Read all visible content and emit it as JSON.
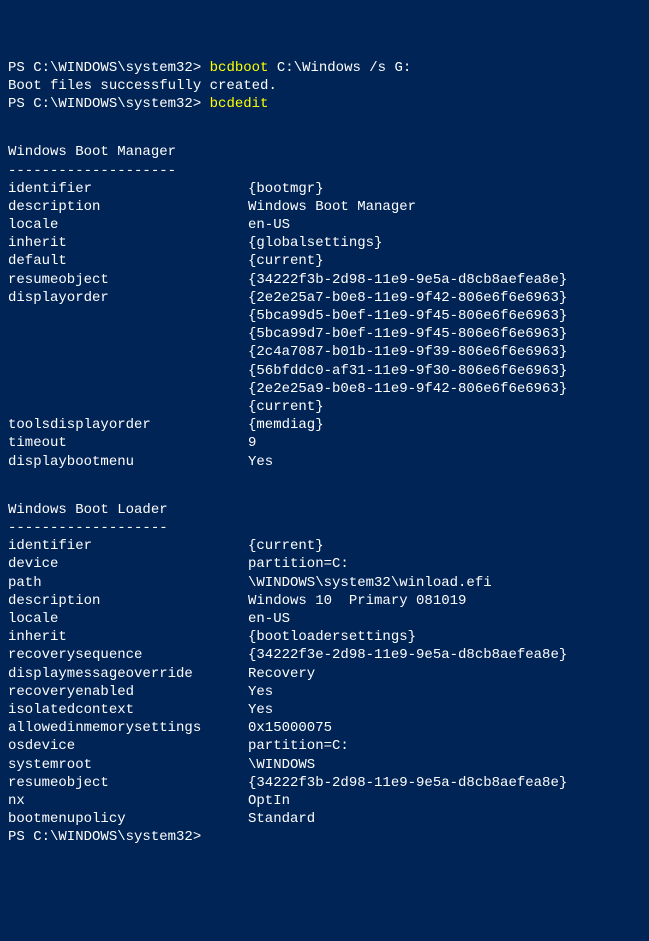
{
  "line1": {
    "prompt": "PS C:\\WINDOWS\\system32> ",
    "cmd": "bcdboot ",
    "args": "C:\\Windows /s G:"
  },
  "line2": "Boot files successfully created.",
  "line3": {
    "prompt": "PS C:\\WINDOWS\\system32> ",
    "cmd": "bcdedit"
  },
  "bootmgr": {
    "title": "Windows Boot Manager",
    "divider": "--------------------",
    "identifier_k": "identifier",
    "identifier_v": "{bootmgr}",
    "description_k": "description",
    "description_v": "Windows Boot Manager",
    "locale_k": "locale",
    "locale_v": "en-US",
    "inherit_k": "inherit",
    "inherit_v": "{globalsettings}",
    "default_k": "default",
    "default_v": "{current}",
    "resumeobject_k": "resumeobject",
    "resumeobject_v": "{34222f3b-2d98-11e9-9e5a-d8cb8aefea8e}",
    "displayorder_k": "displayorder",
    "do1": "{2e2e25a7-b0e8-11e9-9f42-806e6f6e6963}",
    "do2": "{5bca99d5-b0ef-11e9-9f45-806e6f6e6963}",
    "do3": "{5bca99d7-b0ef-11e9-9f45-806e6f6e6963}",
    "do4": "{2c4a7087-b01b-11e9-9f39-806e6f6e6963}",
    "do5": "{56bfddc0-af31-11e9-9f30-806e6f6e6963}",
    "do6": "{2e2e25a9-b0e8-11e9-9f42-806e6f6e6963}",
    "do7": "{current}",
    "toolsdisplayorder_k": "toolsdisplayorder",
    "toolsdisplayorder_v": "{memdiag}",
    "timeout_k": "timeout",
    "timeout_v": "9",
    "displaybootmenu_k": "displaybootmenu",
    "displaybootmenu_v": "Yes"
  },
  "loader": {
    "title": "Windows Boot Loader",
    "divider": "-------------------",
    "identifier_k": "identifier",
    "identifier_v": "{current}",
    "device_k": "device",
    "device_v": "partition=C:",
    "path_k": "path",
    "path_v": "\\WINDOWS\\system32\\winload.efi",
    "description_k": "description",
    "description_v": "Windows 10  Primary 081019",
    "locale_k": "locale",
    "locale_v": "en-US",
    "inherit_k": "inherit",
    "inherit_v": "{bootloadersettings}",
    "recoverysequence_k": "recoverysequence",
    "recoverysequence_v": "{34222f3e-2d98-11e9-9e5a-d8cb8aefea8e}",
    "displaymessageoverride_k": "displaymessageoverride",
    "displaymessageoverride_v": "Recovery",
    "recoveryenabled_k": "recoveryenabled",
    "recoveryenabled_v": "Yes",
    "isolatedcontext_k": "isolatedcontext",
    "isolatedcontext_v": "Yes",
    "allowedinmemorysettings_k": "allowedinmemorysettings",
    "allowedinmemorysettings_v": "0x15000075",
    "osdevice_k": "osdevice",
    "osdevice_v": "partition=C:",
    "systemroot_k": "systemroot",
    "systemroot_v": "\\WINDOWS",
    "resumeobject_k": "resumeobject",
    "resumeobject_v": "{34222f3b-2d98-11e9-9e5a-d8cb8aefea8e}",
    "nx_k": "nx",
    "nx_v": "OptIn",
    "bootmenupolicy_k": "bootmenupolicy",
    "bootmenupolicy_v": "Standard"
  },
  "lastprompt": "PS C:\\WINDOWS\\system32>"
}
